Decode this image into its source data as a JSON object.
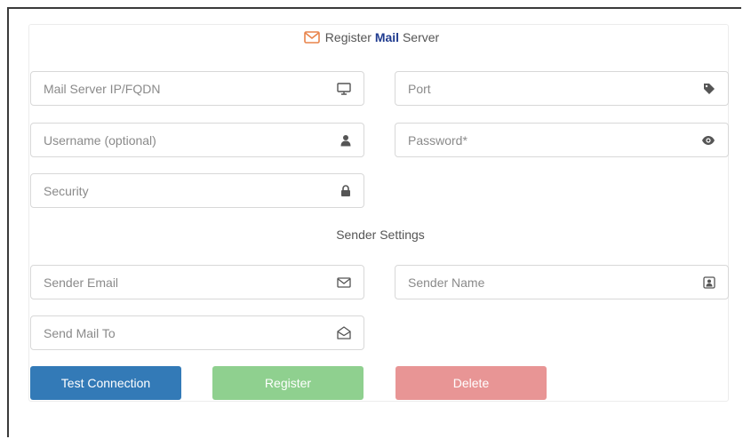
{
  "title": {
    "prefix": "Register ",
    "bold": "Mail",
    "suffix": " Server"
  },
  "fields": {
    "server": {
      "placeholder": "Mail Server IP/FQDN",
      "icon": "monitor-icon"
    },
    "port": {
      "placeholder": "Port",
      "icon": "tag-icon"
    },
    "username": {
      "placeholder": "Username (optional)",
      "icon": "user-icon"
    },
    "password": {
      "placeholder": "Password*",
      "icon": "eye-icon"
    },
    "security": {
      "placeholder": "Security",
      "icon": "lock-icon"
    },
    "sender_email": {
      "placeholder": "Sender Email",
      "icon": "envelope-icon"
    },
    "sender_name": {
      "placeholder": "Sender Name",
      "icon": "contact-card-icon"
    },
    "send_to": {
      "placeholder": "Send Mail To",
      "icon": "envelope-open-icon"
    }
  },
  "section_title": "Sender Settings",
  "buttons": {
    "test": {
      "label": "Test Connection",
      "color": "#337ab7"
    },
    "register": {
      "label": "Register",
      "color": "#8fd08f"
    },
    "delete": {
      "label": "Delete",
      "color": "#e89595"
    }
  },
  "colors": {
    "accent_title": "#1f3b8f",
    "mail_icon": "#e8834a"
  }
}
